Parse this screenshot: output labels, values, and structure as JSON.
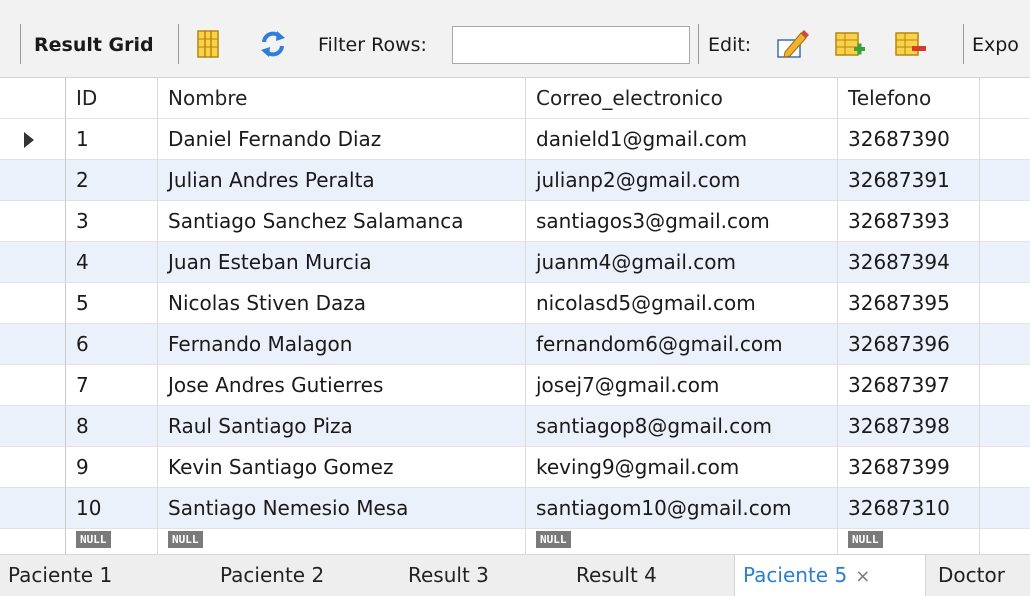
{
  "toolbar": {
    "result_grid_label": "Result Grid",
    "filter_rows_label": "Filter Rows:",
    "filter_value": "",
    "edit_label": "Edit:",
    "export_label": "Expo"
  },
  "grid": {
    "columns": [
      "ID",
      "Nombre",
      "Correo_electronico",
      "Telefono"
    ],
    "rows": [
      {
        "id": "1",
        "nombre": "Daniel Fernando Diaz",
        "correo": "danield1@gmail.com",
        "telefono": "32687390"
      },
      {
        "id": "2",
        "nombre": "Julian Andres Peralta",
        "correo": "julianp2@gmail.com",
        "telefono": "32687391"
      },
      {
        "id": "3",
        "nombre": "Santiago Sanchez Salamanca",
        "correo": "santiagos3@gmail.com",
        "telefono": "32687393"
      },
      {
        "id": "4",
        "nombre": "Juan Esteban Murcia",
        "correo": "juanm4@gmail.com",
        "telefono": "32687394"
      },
      {
        "id": "5",
        "nombre": "Nicolas Stiven Daza",
        "correo": "nicolasd5@gmail.com",
        "telefono": "32687395"
      },
      {
        "id": "6",
        "nombre": "Fernando Malagon",
        "correo": "fernandom6@gmail.com",
        "telefono": "32687396"
      },
      {
        "id": "7",
        "nombre": "Jose Andres Gutierres",
        "correo": "josej7@gmail.com",
        "telefono": "32687397"
      },
      {
        "id": "8",
        "nombre": "Raul Santiago Piza",
        "correo": "santiagop8@gmail.com",
        "telefono": "32687398"
      },
      {
        "id": "9",
        "nombre": "Kevin Santiago Gomez",
        "correo": "keving9@gmail.com",
        "telefono": "32687399"
      },
      {
        "id": "10",
        "nombre": "Santiago Nemesio Mesa",
        "correo": "santiagom10@gmail.com",
        "telefono": "32687310"
      }
    ],
    "null_label": "NULL",
    "new_row_marker": "*"
  },
  "tabs": [
    {
      "label": "Paciente 1",
      "active": false
    },
    {
      "label": "Paciente 2",
      "active": false
    },
    {
      "label": "Result 3",
      "active": false
    },
    {
      "label": "Result 4",
      "active": false
    },
    {
      "label": "Paciente 5",
      "active": true
    },
    {
      "label": "Doctor",
      "active": false
    }
  ],
  "tab_close_glyph": "×",
  "colors": {
    "row_alt": "#eaf1fb",
    "active_tab_text": "#2a7fd0",
    "null_badge": "#7a7a7a"
  },
  "icons": [
    "grid-layout-icon",
    "refresh-icon",
    "edit-pencil-icon",
    "add-row-icon",
    "delete-row-icon"
  ]
}
